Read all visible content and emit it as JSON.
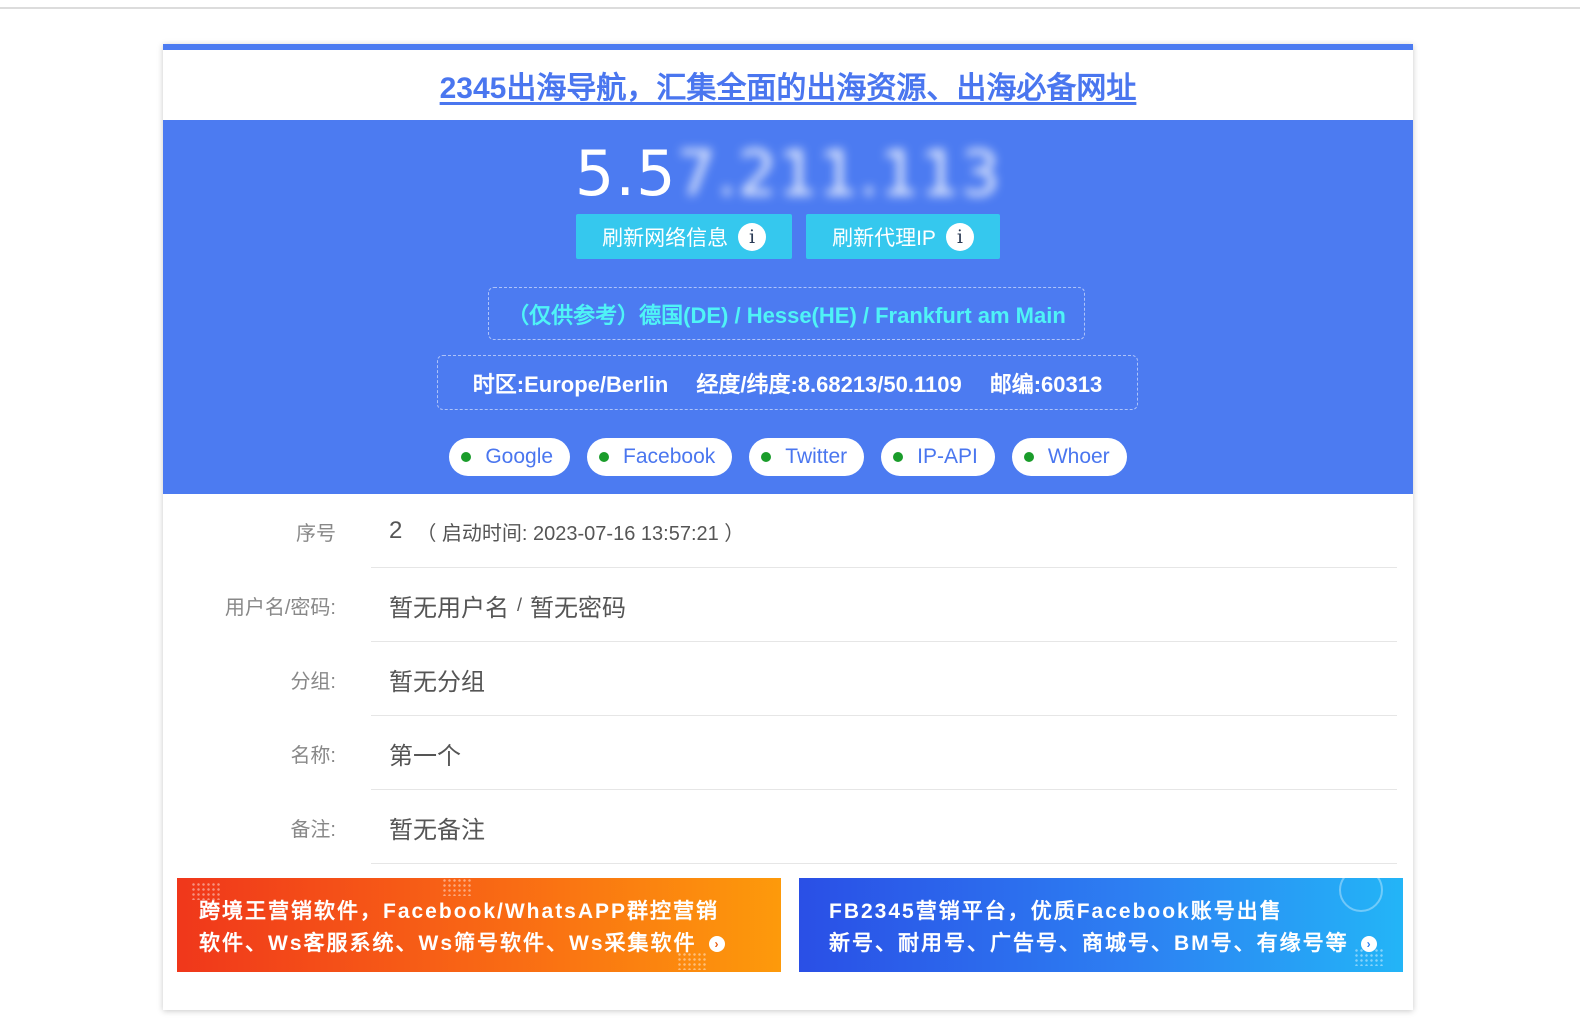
{
  "header": {
    "title": "2345出海导航，汇集全面的出海资源、出海必备网址"
  },
  "ip": {
    "visible_prefix": "5.5",
    "masked_suffix": "7.211.113"
  },
  "buttons": {
    "refresh_network": "刷新网络信息",
    "refresh_proxy": "刷新代理IP",
    "info_glyph": "i"
  },
  "location": "（仅供参考）德国(DE) / Hesse(HE) / Frankfurt am Main",
  "geo": {
    "timezone": "时区:Europe/Berlin",
    "coords": "经度/纬度:8.68213/50.1109",
    "postal": "邮编:60313"
  },
  "checks": [
    {
      "label": "Google"
    },
    {
      "label": "Facebook"
    },
    {
      "label": "Twitter"
    },
    {
      "label": "IP-API"
    },
    {
      "label": "Whoer"
    }
  ],
  "status_color": "#1a9c2a",
  "details": {
    "index_label": "序号",
    "index_value": "2",
    "start_time": "（ 启动时间: 2023-07-16 13:57:21 ）",
    "credentials_label": "用户名/密码:",
    "username": "暂无用户名",
    "cred_sep": "/",
    "password": "暂无密码",
    "group_label": "分组:",
    "group_value": "暂无分组",
    "name_label": "名称:",
    "name_value": "第一个",
    "note_label": "备注:",
    "note_value": "暂无备注"
  },
  "ads": {
    "left_line1": "跨境王营销软件，Facebook/WhatsAPP群控营销",
    "left_line2": "软件、Ws客服系统、Ws筛号软件、Ws采集软件",
    "right_line1": "FB2345营销平台，优质Facebook账号出售",
    "right_line2": "新号、耐用号、广告号、商城号、BM号、有缘号等",
    "arrow_glyph": "›"
  },
  "colors": {
    "accent": "#4c7bf1",
    "button": "#35c8ee",
    "location_text": "#4ff3f6"
  }
}
